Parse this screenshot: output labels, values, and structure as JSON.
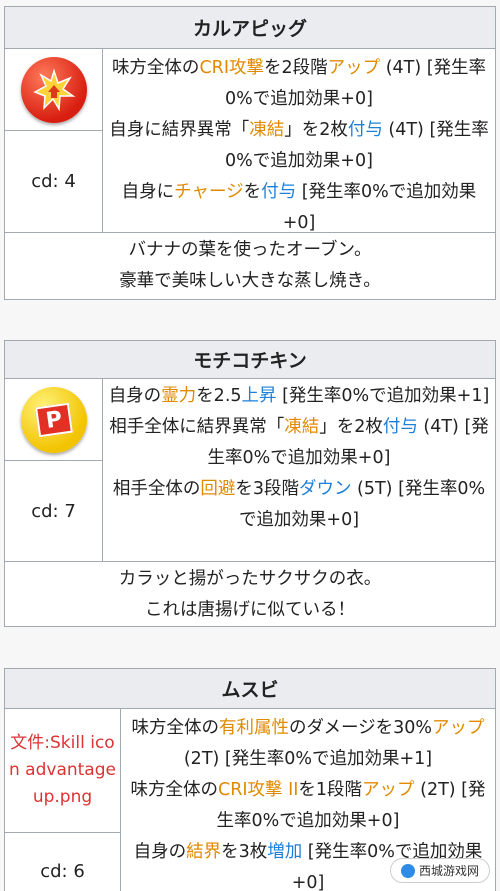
{
  "skills": [
    {
      "name": "カルアピッグ",
      "icon": "star-burst-red-icon",
      "cd": "cd: 4",
      "effects": [
        [
          {
            "t": "味方全体の"
          },
          {
            "t": "CRI攻撃",
            "c": "orange"
          },
          {
            "t": "を2段階"
          },
          {
            "t": "アップ",
            "c": "orange"
          },
          {
            "t": " (4T) [発生率0%で追加効果+0]"
          }
        ],
        [
          {
            "t": "自身に結界異常「"
          },
          {
            "t": "凍結",
            "c": "orange"
          },
          {
            "t": "」を2枚"
          },
          {
            "t": "付与",
            "c": "blue"
          },
          {
            "t": " (4T) [発生率0%で追加効果+0]"
          }
        ],
        [
          {
            "t": "自身に"
          },
          {
            "t": "チャージ",
            "c": "orange"
          },
          {
            "t": "を"
          },
          {
            "t": "付与",
            "c": "blue"
          },
          {
            "t": " [発生率0%で追加効果+0]"
          }
        ]
      ],
      "desc": [
        "バナナの葉を使ったオーブン。",
        "豪華で美味しい大きな蒸し焼き。"
      ]
    },
    {
      "name": "モチコチキン",
      "icon": "p-badge-yellow-icon",
      "icon_letter": "P",
      "cd": "cd: 7",
      "effects": [
        [
          {
            "t": "自身の"
          },
          {
            "t": "霊力",
            "c": "orange"
          },
          {
            "t": "を2.5"
          },
          {
            "t": "上昇",
            "c": "blue"
          },
          {
            "t": " [発生率0%で追加効果+1]"
          }
        ],
        [
          {
            "t": "相手全体に結界異常「"
          },
          {
            "t": "凍結",
            "c": "orange"
          },
          {
            "t": "」を2枚"
          },
          {
            "t": "付与",
            "c": "blue"
          },
          {
            "t": " (4T) [発生率0%で追加効果+0]"
          }
        ],
        [
          {
            "t": "相手全体の"
          },
          {
            "t": "回避",
            "c": "orange"
          },
          {
            "t": "を3段階"
          },
          {
            "t": "ダウン",
            "c": "blue"
          },
          {
            "t": " (5T) [発生率0%で追加効果+0]"
          }
        ]
      ],
      "desc": [
        "カラッと揚がったサクサクの衣。",
        "これは唐揚げに似ている！"
      ]
    },
    {
      "name": "ムスビ",
      "icon_link": "文件:Skill icon advantage up.png",
      "cd": "cd: 6",
      "effects": [
        [
          {
            "t": "味方全体の"
          },
          {
            "t": "有利属性",
            "c": "orange"
          },
          {
            "t": "のダメージを30%"
          },
          {
            "t": "アップ",
            "c": "orange"
          },
          {
            "t": " (2T) [発生率0%で追加効果+1]"
          }
        ],
        [
          {
            "t": "味方全体の"
          },
          {
            "t": "CRI攻撃 II",
            "c": "orange"
          },
          {
            "t": "を1段階"
          },
          {
            "t": "アップ",
            "c": "orange"
          },
          {
            "t": " (2T) [発生率0%で追加効果+0]"
          }
        ],
        [
          {
            "t": "自身の"
          },
          {
            "t": "結界",
            "c": "orange"
          },
          {
            "t": "を3枚"
          },
          {
            "t": "増加",
            "c": "blue"
          },
          {
            "t": " [発生率0%で追加効果+0]"
          }
        ]
      ]
    }
  ],
  "watermark": "西城游戏网"
}
